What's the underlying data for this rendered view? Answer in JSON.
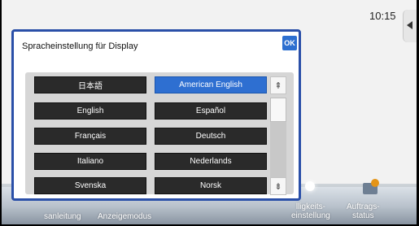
{
  "status": {
    "time": "10:15"
  },
  "dialog": {
    "title": "Spracheinstellung für Display",
    "ok_label": "OK",
    "languages": [
      {
        "label": "日本語",
        "selected": false
      },
      {
        "label": "American English",
        "selected": true
      },
      {
        "label": "English",
        "selected": false
      },
      {
        "label": "Español",
        "selected": false
      },
      {
        "label": "Français",
        "selected": false
      },
      {
        "label": "Deutsch",
        "selected": false
      },
      {
        "label": "Italiano",
        "selected": false
      },
      {
        "label": "Nederlands",
        "selected": false
      },
      {
        "label": "Svenska",
        "selected": false
      },
      {
        "label": "Norsk",
        "selected": false
      }
    ],
    "scroll": {
      "up_icon": "scroll-up-icon",
      "down_icon": "scroll-down-icon"
    }
  },
  "bottom_bar": {
    "items": [
      {
        "label": "sanleitung"
      },
      {
        "label": "Anzeigemodus"
      },
      {
        "label": "lligkeits-\neinstellung"
      },
      {
        "label": "Auftrags-\nstatus"
      }
    ]
  },
  "colors": {
    "accent": "#2e6fd1",
    "dialog_border": "#2a4fa8",
    "status_badge": "#e49417"
  }
}
